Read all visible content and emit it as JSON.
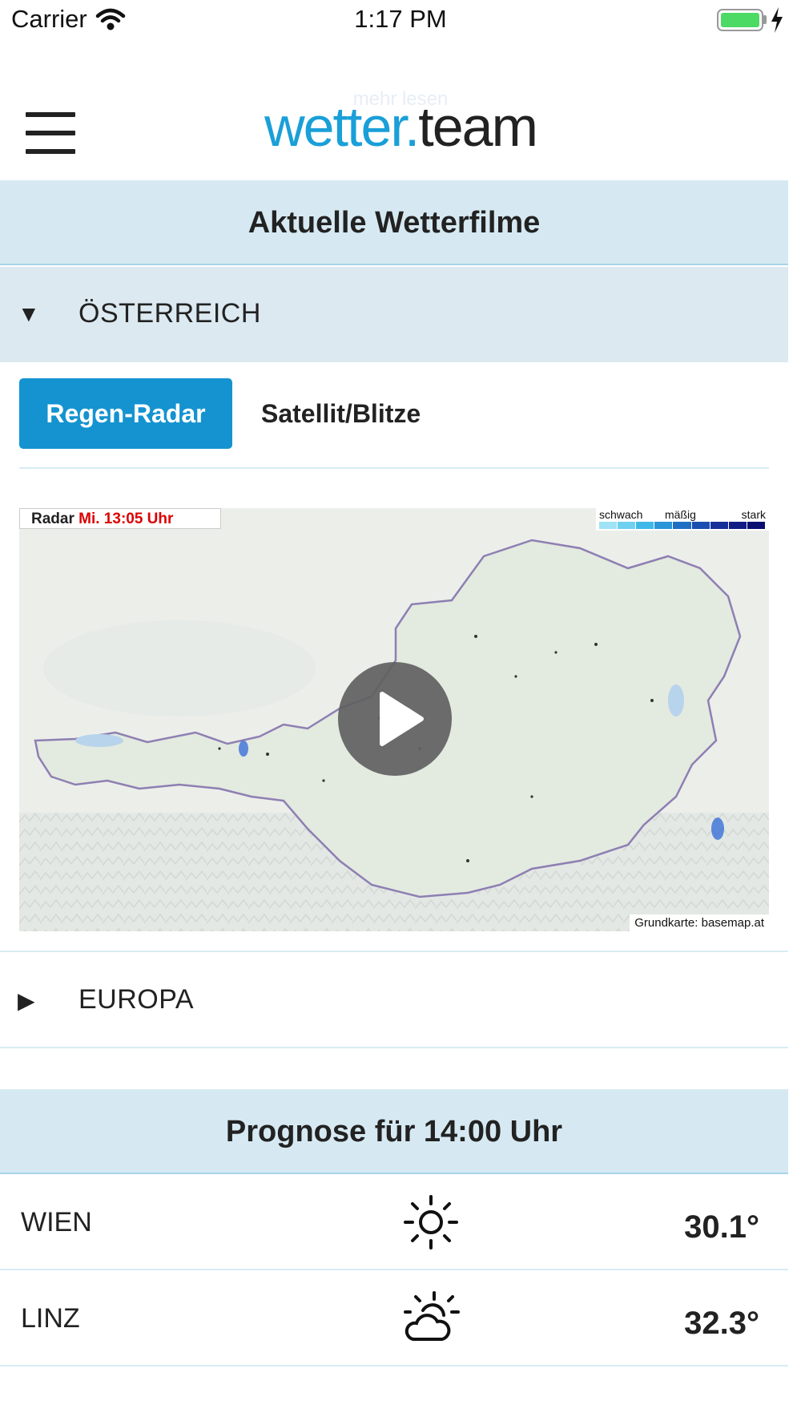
{
  "status_bar": {
    "carrier": "Carrier",
    "time": "1:17 PM"
  },
  "header": {
    "ghost_link": "mehr lesen",
    "logo_part1": "wetter.",
    "logo_part2": "team"
  },
  "films": {
    "title": "Aktuelle Wetterfilme",
    "sections": [
      {
        "label": "ÖSTERREICH",
        "expanded": true,
        "arrow": "▼"
      },
      {
        "label": "EUROPA",
        "expanded": false,
        "arrow": "▶"
      }
    ],
    "tabs": [
      {
        "label": "Regen-Radar",
        "active": true
      },
      {
        "label": "Satellit/Blitze",
        "active": false
      }
    ],
    "radar": {
      "prefix": "Radar",
      "time": "Mi. 13:05 Uhr",
      "legend": [
        "schwach",
        "mäßig",
        "stark"
      ],
      "credit": "Grundkarte: basemap.at"
    }
  },
  "forecast": {
    "title": "Prognose für 14:00 Uhr",
    "rows": [
      {
        "city": "WIEN",
        "icon": "sun-icon",
        "temp": "30.1°"
      },
      {
        "city": "LINZ",
        "icon": "partly-cloudy-icon",
        "temp": "32.3°"
      }
    ]
  },
  "colors": {
    "accent": "#1493d0",
    "bar": "#d6e9f2",
    "logo_blue": "#1a9fd8"
  }
}
